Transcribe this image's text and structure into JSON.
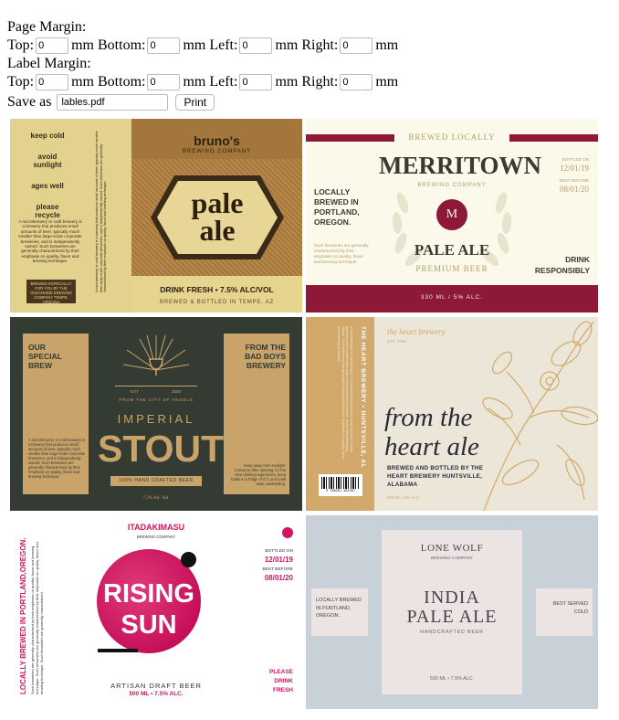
{
  "form": {
    "page_margin_title": "Page Margin:",
    "label_margin_title": "Label Margin:",
    "top": "Top:",
    "bottom": "mm Bottom:",
    "left": "mm Left:",
    "right": "mm Right:",
    "mm": "mm",
    "page_margin": {
      "top": "0",
      "bottom": "0",
      "left": "0",
      "right": "0"
    },
    "label_margin": {
      "top": "0",
      "bottom": "0",
      "left": "0",
      "right": "0"
    },
    "save_as": "Save as",
    "filename": "lables.pdf",
    "print": "Print"
  },
  "labels": {
    "brunos": {
      "tips": [
        "keep cold",
        "avoid sunlight",
        "ages well",
        "please recycle"
      ],
      "desc": "A microbrewery or craft brewery is a brewery that produces small amounts of beer, typically much smaller than large-scale corporate breweries, and is independently owned. Such breweries are generally characterized by their emphasis on quality, flavor and brewing technique.",
      "box": "BREWED ESPECIALLY FOR YOU BY THE OCEANSIDE BREWING COMPANY TEMPE, ARIZONA",
      "brand": "bruno's",
      "company": "BREWING COMPANY",
      "name1": "pale",
      "name2": "ale",
      "drink": "DRINK FRESH • 7.5% ALC/VOL",
      "brewed": "BREWED & BOTTLED IN TEMPE, AZ"
    },
    "merritown": {
      "brewed_locally": "BREWED LOCALLY",
      "brand": "MERRITOWN",
      "company": "BREWING COMPANY",
      "monogram": "M",
      "left_title": "LOCALLY BREWED IN PORTLAND, OREGON.",
      "left_desc": "Such breweries are generally characterized by their emphasis on quality, flavor and brewing technique.",
      "bottled_on_label": "BOTTLED ON",
      "bottled_on": "12/01/19",
      "best_before_label": "BEST BEFORE",
      "best_before": "08/01/20",
      "drink": "DRINK RESPONSIBLY",
      "name": "PALE ALE",
      "sub": "PREMIUM BEER",
      "footer": "330 ML / 5% ALC."
    },
    "stout": {
      "left": "OUR SPECIAL BREW",
      "right": "FROM THE BAD BOYS BREWERY",
      "left_desc": "A microbrewery or craft brewery is a brewery that produces small amounts of beer, typically much smaller than large-scale corporate breweries, and is independently owned. Such breweries are generally characterized by their emphasis on quality, flavor and brewing technique.",
      "right_desc": "Keep away from sunlight. Consume after opening, for the best drinking experience, keep bottle in a fridge of 5°C and it will taste outstanding.",
      "est": "EST",
      "year": "2000",
      "city": "FROM THE CITY OF ANGELS",
      "name1": "IMPERIAL",
      "name2": "STOUT",
      "crafted": "100% HAND CRAFTED BEER",
      "abv": "7.3% Alc. Vol."
    },
    "heart": {
      "side": "THE HEART BREWERY • HUNTSVILLE, AL",
      "brand": "the heart brewery",
      "est": "EST. 2000",
      "name1": "from the",
      "name2": "heart ale",
      "brewed": "BREWED AND BOTTLED BY THE HEART BREWERY HUNTSVILLE, ALABAMA",
      "abv": "500 ML / 8% ALC.",
      "barcode": "9 780201 461367"
    },
    "rising": {
      "side": "LOCALLY BREWED IN PORTLAND,OREGON.",
      "side_desc": "Such breweries are generally characterized by their emphasis on quality, flavor and brewing technique. Such breweries are generally characterized by their emphasis on quality, flavor and brewing technique. Such breweries are generally characterized.",
      "brand": "ITADAKIMASU",
      "company": "BREWING COMPANY",
      "name1": "RISING",
      "name2": "SUN",
      "bottled_on_label": "BOTTLED ON",
      "bottled_on": "12/01/19",
      "best_before_label": "BEST BEFORE",
      "best_before": "08/01/20",
      "drink": "PLEASE DRINK FRESH",
      "artisan": "ARTISAN DRAFT BEER",
      "abv": "500 ML  •  7.5% ALC."
    },
    "lonewolf": {
      "left": "LOCALLY BREWED IN PORTLAND, OREGON.",
      "right": "BEST SERVED COLD",
      "brand": "LONE WOLF",
      "company": "BREWING COMPANY",
      "name1": "INDIA",
      "name2": "PALE ALE",
      "crafted": "HANDCRAFTED BEER",
      "abv": "500 ML  •  7.5% ALC."
    }
  },
  "colors": {
    "page_bg": "#ffffff",
    "brunos_bg": "#e3d28d",
    "brunos_brown": "#a3773b",
    "brunos_dark": "#3a2a1a",
    "merritown_bg": "#fbf9ea",
    "merritown_red": "#8e1838",
    "merritown_dark": "#3b3a30",
    "merritown_gold": "#b59c67",
    "stout_bg": "#343b33",
    "stout_gold": "#c8a36a",
    "heart_bg": "#ebe6d7",
    "heart_tan": "#d2a96a",
    "rising_pink": "#d0145f",
    "lonewolf_bg": "#c8d0d8",
    "lonewolf_panel": "#ece4e3"
  }
}
